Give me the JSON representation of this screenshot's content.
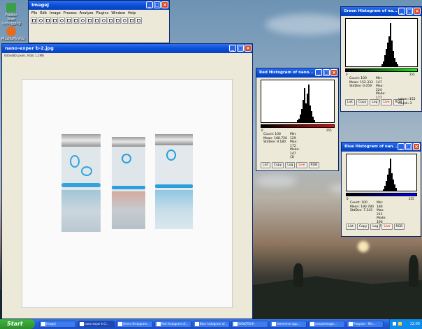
{
  "desktop": {
    "icons": [
      {
        "label": "Fiddler Web Debugging",
        "icon": "app-icon",
        "color": "#3b9e4a"
      },
      {
        "label": "MozillaFirefox",
        "icon": "firefox-icon",
        "color": "#e66a1f"
      }
    ]
  },
  "imagej": {
    "title": "ImageJ",
    "menu": [
      "File",
      "Edit",
      "Image",
      "Process",
      "Analyze",
      "Plugins",
      "Window",
      "Help"
    ],
    "tools": [
      "rectangle-tool-icon",
      "oval-tool-icon",
      "polygon-tool-icon",
      "freehand-tool-icon",
      "line-tool-icon",
      "angle-tool-icon",
      "point-tool-icon",
      "wand-tool-icon",
      "text-tool-icon",
      "magnifier-tool-icon",
      "hand-tool-icon",
      "dropper-tool-icon",
      "custom-tool-icon",
      "arrow-tool-icon",
      "brush-tool-icon",
      "more-tools-icon"
    ]
  },
  "image_window": {
    "title": "nano-exper b-2.jpg",
    "info": "640x480 pixels; RGB; 1.2MB"
  },
  "red_hist": {
    "title": "Red Histogram of nano...",
    "axis_min": "0",
    "axis_max": "255",
    "stats_left": [
      "Count: 100",
      "Mean: 168.720",
      "StdDev: 9.180"
    ],
    "stats_right": [
      "Min: 129",
      "Max: 172",
      "Mode: 147 (3)"
    ],
    "buttons": [
      "List",
      "Copy",
      "Log",
      "Live",
      "RGB"
    ],
    "color": "#cc0000",
    "bins": [
      0.05,
      0.1,
      0.2,
      0.35,
      0.6,
      0.9,
      0.5,
      0.75,
      1.0,
      0.45,
      0.3,
      0.15,
      0.06
    ]
  },
  "green_hist": {
    "title": "Green Histogram of na...",
    "axis_min": "0",
    "axis_max": "255",
    "stats_left": [
      "Count: 100",
      "Mean: 152.333",
      "StdDev: 6.059"
    ],
    "stats_right": [
      "Min: 147",
      "Max: 224",
      "Mode: 177 (3)"
    ],
    "extra": [
      "value=152",
      "count=3"
    ],
    "buttons": [
      "List",
      "Copy",
      "Log",
      "Live",
      "RGB"
    ],
    "color": "#00aa00",
    "bins": [
      0.05,
      0.12,
      0.25,
      0.4,
      0.55,
      0.7,
      1.0,
      0.6,
      0.35,
      0.2,
      0.1,
      0.05
    ]
  },
  "blue_hist": {
    "title": "Blue Histogram of nan...",
    "axis_min": "0",
    "axis_max": "255",
    "stats_left": [
      "Count: 100",
      "Mean: 190.780",
      "StdDev: 7.343"
    ],
    "stats_right": [
      "Min: 186",
      "Max: 215",
      "Mode: 190 (5)"
    ],
    "buttons": [
      "List",
      "Copy",
      "Log",
      "Live",
      "RGB"
    ],
    "color": "#0000cc",
    "bins": [
      0.05,
      0.15,
      0.3,
      0.5,
      0.7,
      1.0,
      0.55,
      0.35,
      0.2,
      0.08
    ]
  },
  "taskbar": {
    "start": "Start",
    "items": [
      "ImageJ",
      "nano-exper b-2...",
      "Green Histogram...",
      "Red histogram of...",
      "Blue histogram of...",
      "NANOTECH",
      "hemmmm-app...",
      "sampleimage...",
      "Program - Mic..."
    ],
    "clock": "12:00"
  }
}
